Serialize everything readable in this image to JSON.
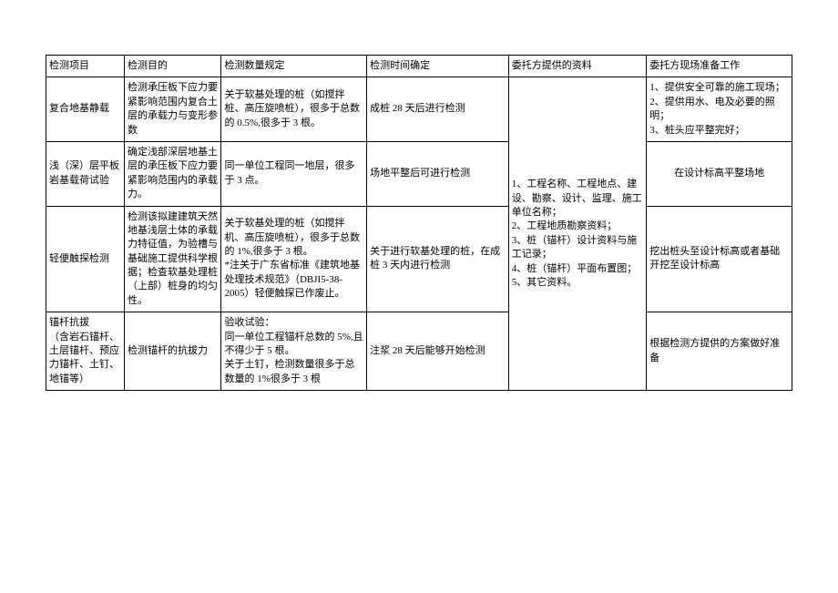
{
  "headers": {
    "c1": "检测项目",
    "c2": "检测目的",
    "c3": "检测数量规定",
    "c4": "检测时间确定",
    "c5": "委托方提供的资料",
    "c6": "委托方现场准备工作"
  },
  "rows": [
    {
      "c1": "复合地基静载",
      "c2": "检测承压板下应力要紧影响范围内复合土层的承载力与变形参数",
      "c3": "关于软基处理的桩（如搅拌桩、高压旋喷桩），很多于总数的 0.5%,很多于 3 根。",
      "c4": "成桩 28 天后进行检测",
      "c6": "1、提供安全可靠的施工现场；\n2、提供用水、电及必要的照明；\n3、桩头应平整完好；"
    },
    {
      "c1": "浅（深）层平板岩基载荷试验",
      "c2": "确定浅部深层地基土层的承压板下应力要紧影响范围内的承载力。",
      "c3": "同一单位工程同一地层，很多于 3 点。",
      "c4": "场地平整后可进行检测",
      "c6": "在设计标高平整场地"
    },
    {
      "c1": "轻便触探检测",
      "c2": "检测该拟建建筑天然地基浅层土体的承载力特征值，为验槽与基础施工提供科学根据；检查软基处理桩（上部）桩身的均匀性。",
      "c3": "关于软基处理的桩（如搅拌机、高压旋喷桩），很多于总数的 1%,很多于 3 根。\n*注关于广东省标准《建筑地基处理技术规范》（DBJI5-38-2005）轻便触探已作废止。",
      "c4": "关于进行软基处理的桩，在成桩 3 天内进行检测",
      "c6": "挖出桩头至设计标高或者基础开挖至设计标高"
    },
    {
      "c1": "锚杆抗拔\n（含岩石锚杆、土层锚杆、预应力锚杆、土钉、地锚等）",
      "c2": "检测锚杆的抗拔力",
      "c3": "验收试验：\n同一单位工程锚杆总数的 5%,且不得少于 5 根。\n关于土钉，检测数量很多于总数量的 1%很多于 3 根",
      "c4": "注浆 28 天后能够开始检测",
      "c6": "根据检测方提供的方案做好准备"
    }
  ],
  "shared": {
    "c5": "1、工程名称、工程地点、建设、勘察、设计、监理、施工单位名称；\n2、工程地质勘察资料；\n3、桩（锚杆）设计资料与施工记录；\n4、桩（锚杆）平面布置图；\n5、其它资料。"
  }
}
